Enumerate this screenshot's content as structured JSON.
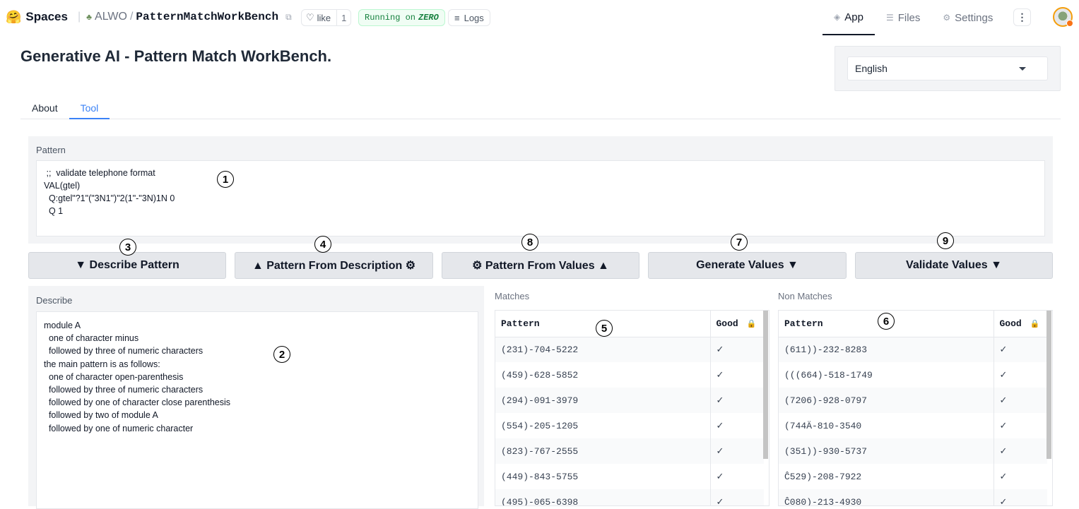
{
  "topbar": {
    "brand_logo": "🤗",
    "brand": "Spaces",
    "owner": "ALWO",
    "repo": "PatternMatchWorkBench",
    "like_label": "like",
    "like_count": "1",
    "running_prefix": "Running on",
    "running_hw": "ZERO",
    "logs_label": "Logs",
    "nav": [
      {
        "label": "App",
        "icon": "cube-icon"
      },
      {
        "label": "Files",
        "icon": "files-icon"
      },
      {
        "label": "Settings",
        "icon": "gear-icon"
      }
    ],
    "more": "⋮"
  },
  "app": {
    "title": "Generative AI - Pattern Match WorkBench.",
    "language": "English",
    "tabs": [
      "About",
      "Tool"
    ],
    "active_tab": "Tool",
    "pattern_label": "Pattern",
    "pattern_text": " ;;  validate telephone format\nVAL(gtel)\n  Q:gtel\"?1\"(\"3N1\")\"2(1\"-\"3N)1N 0\n  Q 1",
    "buttons": {
      "describe": "▼ Describe Pattern",
      "from_description": "▲ Pattern From Description ⚙",
      "from_values": "⚙ Pattern From Values ▲",
      "generate": "Generate Values ▼",
      "validate": "Validate Values ▼"
    },
    "describe_label": "Describe",
    "describe_text": "module A\n  one of character minus\n  followed by three of numeric characters\nthe main pattern is as follows:\n  one of character open-parenthesis\n  followed by three of numeric characters\n  followed by one of character close parenthesis\n  followed by two of module A\n  followed by one of numeric character",
    "matches_label": "Matches",
    "non_matches_label": "Non Matches",
    "col_pattern": "Pattern",
    "col_good": "Good",
    "matches": [
      {
        "value": "(231)-704-5222",
        "good": "✓"
      },
      {
        "value": "(459)-628-5852",
        "good": "✓"
      },
      {
        "value": "(294)-091-3979",
        "good": "✓"
      },
      {
        "value": "(554)-205-1205",
        "good": "✓"
      },
      {
        "value": "(823)-767-2555",
        "good": "✓"
      },
      {
        "value": "(449)-843-5755",
        "good": "✓"
      },
      {
        "value": "(495)-065-6398",
        "good": "✓"
      }
    ],
    "non_matches": [
      {
        "value": "(611))-232-8283",
        "good": "✓"
      },
      {
        "value": "(((664)-518-1749",
        "good": "✓"
      },
      {
        "value": "(7206)-928-0797",
        "good": "✓"
      },
      {
        "value": "(744Ä-810-3540",
        "good": "✓"
      },
      {
        "value": "(351))-930-5737",
        "good": "✓"
      },
      {
        "value": "Ĉ529)-208-7922",
        "good": "✓"
      },
      {
        "value": "Ĉ080)-213-4930",
        "good": "✓"
      }
    ],
    "annotations": [
      "1",
      "2",
      "3",
      "4",
      "5",
      "6",
      "7",
      "8",
      "9"
    ]
  }
}
